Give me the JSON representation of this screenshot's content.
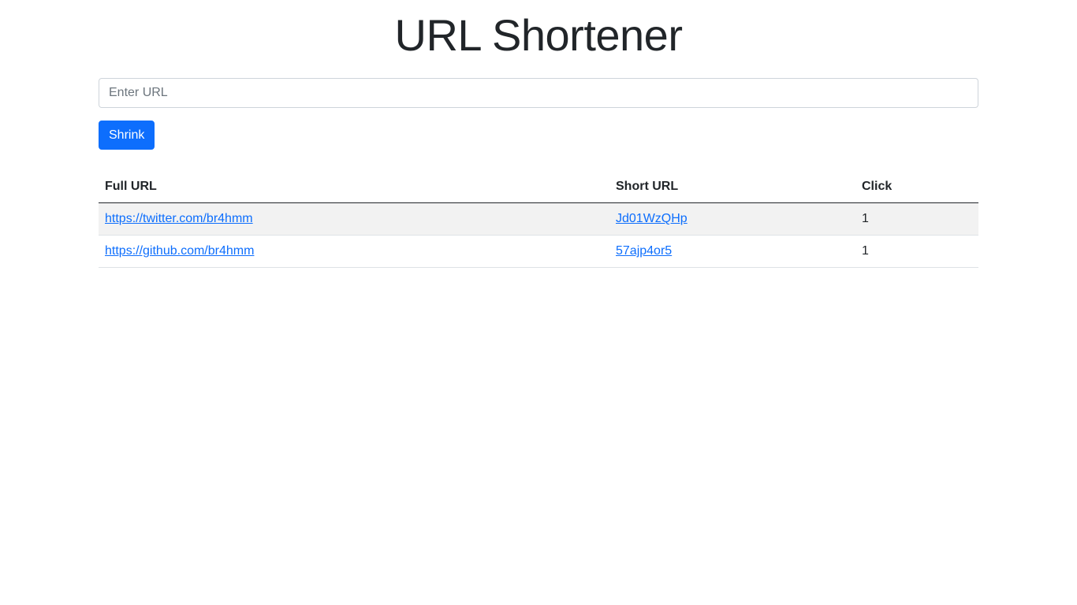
{
  "header": {
    "title": "URL Shortener"
  },
  "form": {
    "url_placeholder": "Enter URL",
    "url_value": "",
    "submit_label": "Shrink"
  },
  "table": {
    "columns": [
      "Full URL",
      "Short URL",
      "Click"
    ],
    "rows": [
      {
        "full_url": "https://twitter.com/br4hmm",
        "short_url": "Jd01WzQHp",
        "clicks": "1"
      },
      {
        "full_url": "https://github.com/br4hmm",
        "short_url": "57ajp4or5",
        "clicks": "1"
      }
    ]
  },
  "colors": {
    "primary": "#0d6efd",
    "text": "#212529",
    "striped_row": "#f2f2f2",
    "input_border": "#ced4da"
  }
}
